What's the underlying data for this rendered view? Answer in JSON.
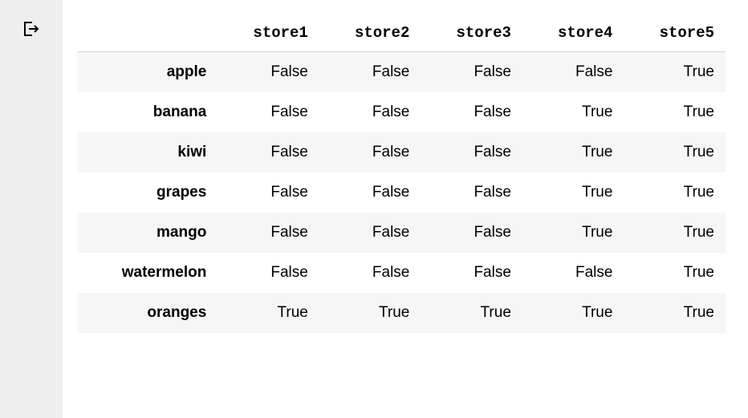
{
  "table": {
    "columns": [
      "store1",
      "store2",
      "store3",
      "store4",
      "store5"
    ],
    "index": [
      "apple",
      "banana",
      "kiwi",
      "grapes",
      "mango",
      "watermelon",
      "oranges"
    ],
    "data": [
      [
        "False",
        "False",
        "False",
        "False",
        "True"
      ],
      [
        "False",
        "False",
        "False",
        "True",
        "True"
      ],
      [
        "False",
        "False",
        "False",
        "True",
        "True"
      ],
      [
        "False",
        "False",
        "False",
        "True",
        "True"
      ],
      [
        "False",
        "False",
        "False",
        "True",
        "True"
      ],
      [
        "False",
        "False",
        "False",
        "False",
        "True"
      ],
      [
        "True",
        "True",
        "True",
        "True",
        "True"
      ]
    ]
  }
}
